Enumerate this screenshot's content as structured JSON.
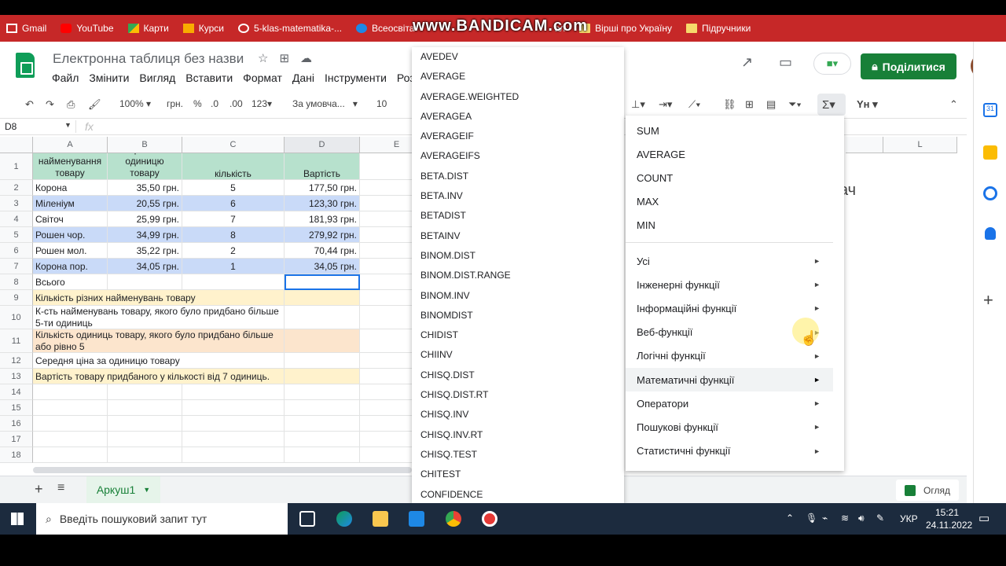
{
  "bookmarks": [
    {
      "label": "Gmail"
    },
    {
      "label": "YouTube"
    },
    {
      "label": "Карти"
    },
    {
      "label": "Курси"
    },
    {
      "label": "5-klas-matematika-..."
    },
    {
      "label": "Всеосвіта"
    },
    {
      "label": "ал"
    },
    {
      "label": "Вірші про Україну"
    },
    {
      "label": "Підручники"
    }
  ],
  "watermark": "www.BANDICAM.com",
  "doc": {
    "title": "Електронна таблиця без назви",
    "share_label": "Поділитися"
  },
  "menu": [
    "Файл",
    "Змінити",
    "Вигляд",
    "Вставити",
    "Формат",
    "Дані",
    "Інструменти",
    "Роз"
  ],
  "toolbar": {
    "zoom": "100%",
    "currency": "грн.",
    "percent": "%",
    "dec_less": ".0",
    "dec_more": ".00",
    "format_more": "123",
    "font": "За умовча...",
    "size": "10"
  },
  "namebox": "D8",
  "fx": "fx",
  "columns": [
    "A",
    "B",
    "C",
    "D",
    "E",
    "L"
  ],
  "rows": [
    {
      "n": "1",
      "a": "найменування товару",
      "b": "Ціна за одиницю товару",
      "c": "кількість",
      "d": "Вартість"
    },
    {
      "n": "2",
      "a": "Корона",
      "b": "35,50 грн.",
      "c": "5",
      "d": "177,50 грн."
    },
    {
      "n": "3",
      "a": "Міленіум",
      "b": "20,55 грн.",
      "c": "6",
      "d": "123,30 грн."
    },
    {
      "n": "4",
      "a": "Світоч",
      "b": "25,99 грн.",
      "c": "7",
      "d": "181,93 грн."
    },
    {
      "n": "5",
      "a": "Рошен чор.",
      "b": "34,99 грн.",
      "c": "8",
      "d": "279,92 грн."
    },
    {
      "n": "6",
      "a": "Рошен мол.",
      "b": "35,22 грн.",
      "c": "2",
      "d": "70,44 грн."
    },
    {
      "n": "7",
      "a": "Корона пор.",
      "b": "34,05 грн.",
      "c": "1",
      "d": "34,05 грн."
    },
    {
      "n": "8",
      "a": "Всього",
      "b": "",
      "c": "",
      "d": ""
    },
    {
      "n": "9",
      "a": "Кількість різних найменувань товару",
      "b": "",
      "c": "",
      "d": ""
    },
    {
      "n": "10",
      "a": "К-сть найменувань товару, якого було придбано більше 5-ти одиниць",
      "b": "",
      "c": "",
      "d": ""
    },
    {
      "n": "11",
      "a": "Кількість одиниць товару, якого було придбано більше або рівно 5",
      "b": "",
      "c": "",
      "d": ""
    },
    {
      "n": "12",
      "a": "Середня ціна за одиницю товару",
      "b": "",
      "c": "",
      "d": ""
    },
    {
      "n": "13",
      "a": "Вартість товару придбаного у кількості від 7 одиниць.",
      "b": "",
      "c": "",
      "d": ""
    },
    {
      "n": "14",
      "a": "",
      "b": "",
      "c": "",
      "d": ""
    },
    {
      "n": "15",
      "a": "",
      "b": "",
      "c": "",
      "d": ""
    },
    {
      "n": "16",
      "a": "",
      "b": "",
      "c": "",
      "d": ""
    },
    {
      "n": "17",
      "a": "",
      "b": "",
      "c": "",
      "d": ""
    },
    {
      "n": "18",
      "a": "",
      "b": "",
      "c": "",
      "d": ""
    }
  ],
  "side_text": "ач",
  "sheet_tab": "Аркуш1",
  "explore": "Огляд",
  "function_list": [
    "AVEDEV",
    "AVERAGE",
    "AVERAGE.WEIGHTED",
    "AVERAGEA",
    "AVERAGEIF",
    "AVERAGEIFS",
    "BETA.DIST",
    "BETA.INV",
    "BETADIST",
    "BETAINV",
    "BINOM.DIST",
    "BINOM.DIST.RANGE",
    "BINOM.INV",
    "BINOMDIST",
    "CHIDIST",
    "CHIINV",
    "CHISQ.DIST",
    "CHISQ.DIST.RT",
    "CHISQ.INV",
    "CHISQ.INV.RT",
    "CHISQ.TEST",
    "CHITEST",
    "CONFIDENCE"
  ],
  "function_menu": {
    "quick": [
      "SUM",
      "AVERAGE",
      "COUNT",
      "MAX",
      "MIN"
    ],
    "categories": [
      "Усі",
      "Інженерні функції",
      "Інформаційні функції",
      "Веб-функції",
      "Логічні функції",
      "Математичні функції",
      "Оператори",
      "Пошукові функції",
      "Статистичні функції"
    ],
    "highlighted": "Математичні функції",
    "arrow": "►"
  },
  "taskbar": {
    "search_placeholder": "Введіть пошуковий запит тут",
    "lang": "УКР",
    "time": "15:21",
    "date": "24.11.2022"
  }
}
